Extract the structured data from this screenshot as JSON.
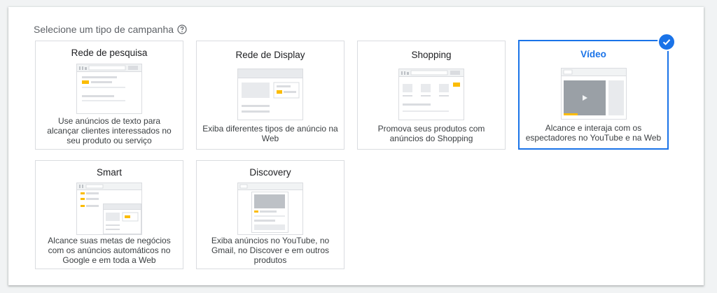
{
  "section": {
    "title": "Selecione um tipo de campanha",
    "help_icon": "help-circle-icon"
  },
  "campaign_types": [
    {
      "title": "Rede de pesquisa",
      "description": "Use anúncios de texto para alcançar clientes interessados no seu produto ou serviço"
    },
    {
      "title": "Rede de Display",
      "description": "Exiba diferentes tipos de anúncio na Web"
    },
    {
      "title": "Shopping",
      "description": "Promova seus produtos com anúncios do Shopping"
    },
    {
      "title": "Vídeo",
      "description": "Alcance e interaja com os espectadores no YouTube e na Web",
      "selected": true
    },
    {
      "title": "Smart",
      "description": "Alcance suas metas de negócios com os anúncios automáticos no Google e em toda a Web"
    },
    {
      "title": "Discovery",
      "description": "Exiba anúncios no YouTube, no Gmail, no Discover e em outros produtos"
    }
  ],
  "colors": {
    "accent": "#1a73e8",
    "highlight": "#fbbc04",
    "placeholder": "#dadce0"
  }
}
